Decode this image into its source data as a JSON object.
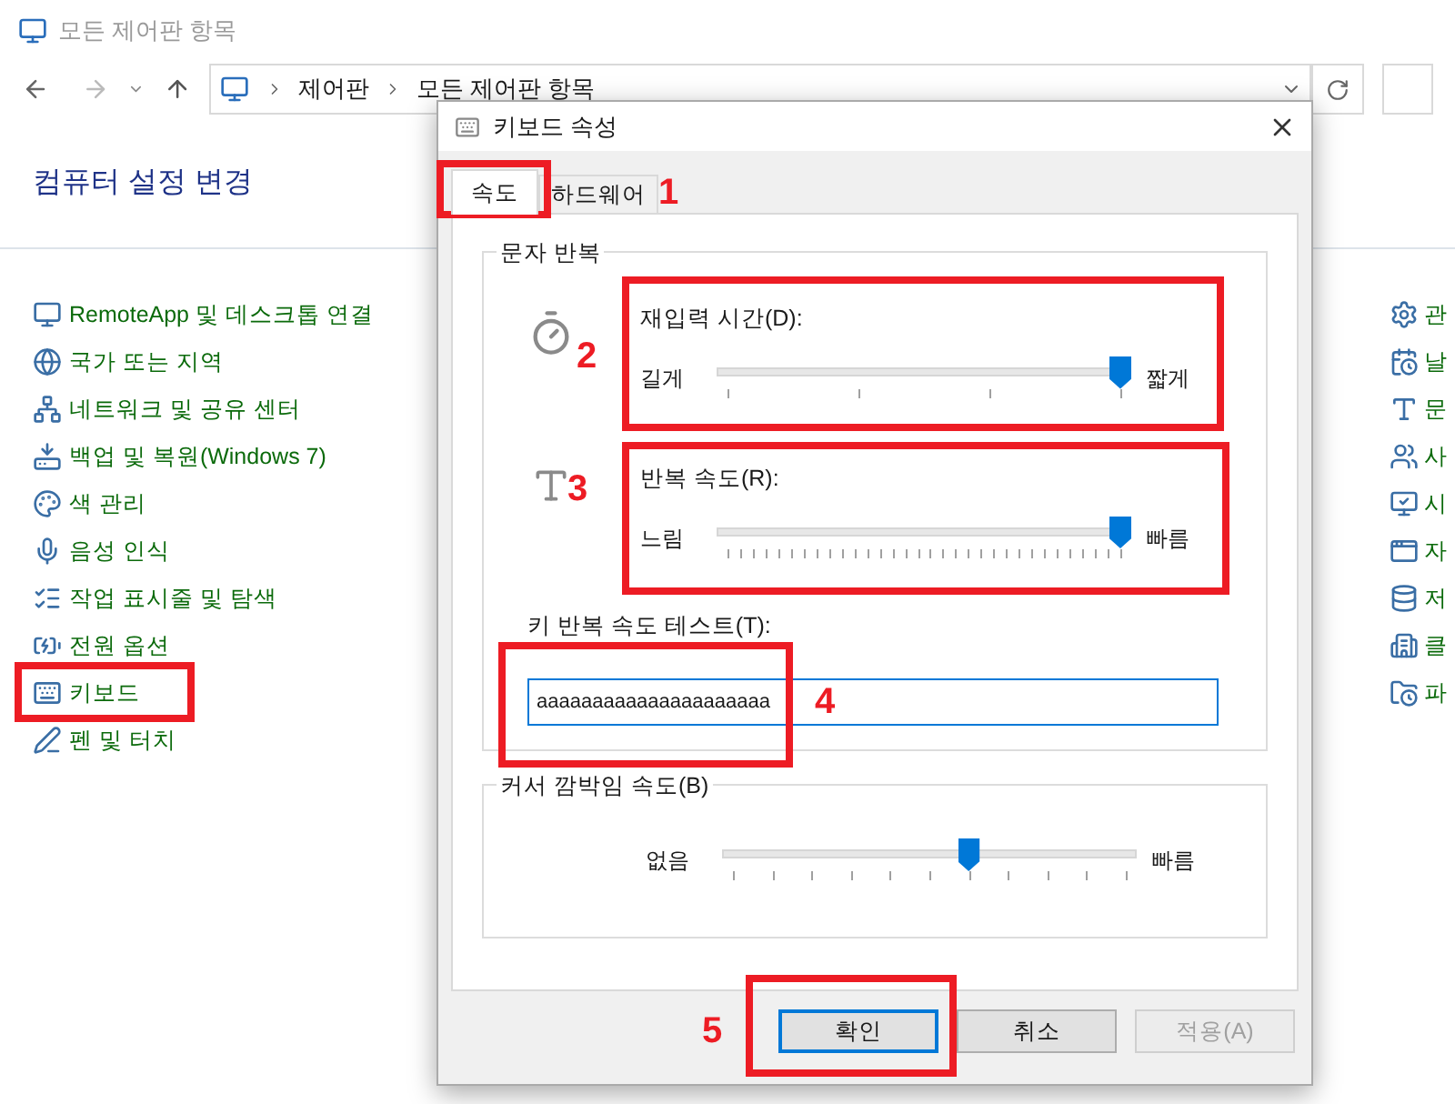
{
  "window": {
    "title": "모든 제어판 항목"
  },
  "breadcrumb": [
    "제어판",
    "모든 제어판 항목"
  ],
  "heading": "컴퓨터 설정 변경",
  "left_items": [
    {
      "label": "RemoteApp 및 데스크톱 연결"
    },
    {
      "label": "국가 또는 지역"
    },
    {
      "label": "네트워크 및 공유 센터"
    },
    {
      "label": "백업 및 복원(Windows 7)"
    },
    {
      "label": "색 관리"
    },
    {
      "label": "음성 인식"
    },
    {
      "label": "작업 표시줄 및 탐색"
    },
    {
      "label": "전원 옵션"
    },
    {
      "label": "키보드"
    },
    {
      "label": "펜 및 터치"
    }
  ],
  "right_items": [
    {
      "label": "관"
    },
    {
      "label": "날"
    },
    {
      "label": "문"
    },
    {
      "label": "사"
    },
    {
      "label": "시"
    },
    {
      "label": "자"
    },
    {
      "label": "저"
    },
    {
      "label": "클"
    },
    {
      "label": "파"
    }
  ],
  "dialog": {
    "title": "키보드 속성",
    "tabs": [
      {
        "label": "속도",
        "selected": true
      },
      {
        "label": "하드웨어",
        "selected": false
      }
    ],
    "repeat_group": {
      "title": "문자 반복",
      "delay": {
        "label": "재입력 시간(D):",
        "min_label": "길게",
        "max_label": "짧게",
        "level": 1
      },
      "rate": {
        "label": "반복 속도(R):",
        "min_label": "느림",
        "max_label": "빠름",
        "level": 1
      },
      "test_label": "키 반복 속도 테스트(T):",
      "test_value": "aaaaaaaaaaaaaaaaaaaaa"
    },
    "blink_group": {
      "title": "커서 깜박임 속도(B)",
      "min_label": "없음",
      "max_label": "빠름",
      "level": 0.6
    },
    "buttons": [
      {
        "label": "확인",
        "default": true,
        "disabled": false
      },
      {
        "label": "취소",
        "default": false,
        "disabled": false
      },
      {
        "label": "적용(A)",
        "default": false,
        "disabled": true
      }
    ]
  },
  "annotations": [
    "1",
    "2",
    "3",
    "4",
    "5"
  ]
}
